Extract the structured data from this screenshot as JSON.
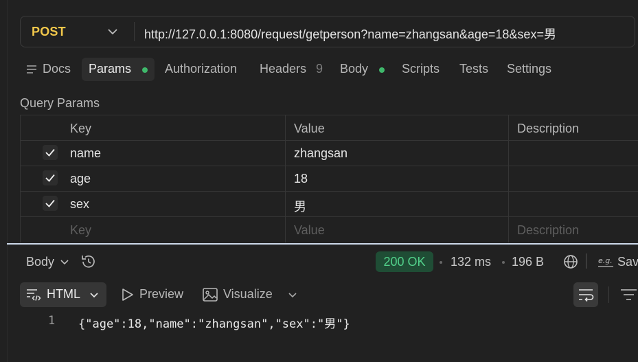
{
  "request": {
    "method": "POST",
    "url": "http://127.0.0.1:8080/request/getperson?name=zhangsan&age=18&sex=男"
  },
  "tabs": [
    {
      "label": "Docs",
      "icon": "docs-icon"
    },
    {
      "label": "Params",
      "active": true,
      "dot": true
    },
    {
      "label": "Authorization"
    },
    {
      "label": "Headers",
      "count": "9"
    },
    {
      "label": "Body",
      "dot": true
    },
    {
      "label": "Scripts"
    },
    {
      "label": "Tests"
    },
    {
      "label": "Settings"
    }
  ],
  "query_params": {
    "title": "Query Params",
    "headers": {
      "key": "Key",
      "value": "Value",
      "description": "Description"
    },
    "rows": [
      {
        "key": "name",
        "value": "zhangsan",
        "description": "",
        "checked": true
      },
      {
        "key": "age",
        "value": "18",
        "description": "",
        "checked": true
      },
      {
        "key": "sex",
        "value": "男",
        "description": "",
        "checked": true
      }
    ],
    "placeholder": {
      "key": "Key",
      "value": "Value",
      "description": "Description"
    }
  },
  "response": {
    "body_label": "Body",
    "status": "200 OK",
    "time": "132 ms",
    "size": "196 B",
    "save_label": "Sav",
    "format": "HTML",
    "preview_label": "Preview",
    "visualize_label": "Visualize",
    "line_number": "1",
    "code": "{\"age\":18,\"name\":\"zhangsan\",\"sex\":\"男\"}"
  },
  "colors": {
    "method": "#f2c84b",
    "status_bg": "#1f4d35",
    "status_text": "#52d08a",
    "dot": "#3fb86b",
    "accent_line": "#cdd9ea"
  }
}
